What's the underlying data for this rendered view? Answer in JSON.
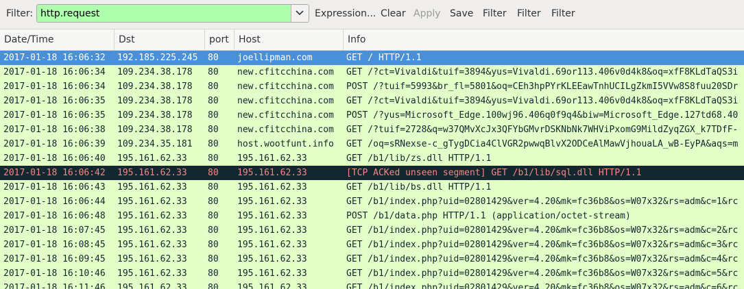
{
  "filter": {
    "label": "Filter:",
    "value": "http.request"
  },
  "toolbar": {
    "expression": "Expression...",
    "clear": "Clear",
    "apply": "Apply",
    "save": "Save",
    "filter_button_1": "Filter",
    "filter_button_2": "Filter",
    "filter_button_3": "Filter"
  },
  "columns": [
    "Date/Time",
    "Dst",
    "port",
    "Host",
    "Info"
  ],
  "colors": {
    "http_row_bg": "#e4ffc7",
    "selected_bg": "#4a90d9",
    "selected_fg": "#ffffff",
    "tcp_error_bg": "#12272e",
    "tcp_error_fg": "#f78787",
    "filter_valid_bg": "#afffaf"
  },
  "rows": [
    {
      "date": "2017-01-18 16:06:32",
      "dst": "192.185.225.245",
      "port": "80",
      "host": "joellipman.com",
      "info": "GET / HTTP/1.1",
      "style": "selected"
    },
    {
      "date": "2017-01-18 16:06:34",
      "dst": "109.234.38.178",
      "port": "80",
      "host": "new.cfitcchina.com",
      "info": "GET /?ct=Vivaldi&tuif=3894&yus=Vivaldi.69or113.406v0d4k8&oq=xfF8KLdTaQS3i",
      "style": "http"
    },
    {
      "date": "2017-01-18 16:06:34",
      "dst": "109.234.38.178",
      "port": "80",
      "host": "new.cfitcchina.com",
      "info": "POST /?tuif=5993&br_fl=5801&oq=CEh3hpPYrKLEEawTnhUCILgZkmI5VVw8S8fuu20SDr",
      "style": "http"
    },
    {
      "date": "2017-01-18 16:06:35",
      "dst": "109.234.38.178",
      "port": "80",
      "host": "new.cfitcchina.com",
      "info": "GET /?ct=Vivaldi&tuif=3894&yus=Vivaldi.69or113.406v0d4k8&oq=xfF8KLdTaQS3i",
      "style": "http"
    },
    {
      "date": "2017-01-18 16:06:35",
      "dst": "109.234.38.178",
      "port": "80",
      "host": "new.cfitcchina.com",
      "info": "POST /?yus=Microsoft_Edge.100wj96.406q0f9q4&biw=Microsoft_Edge.127td68.40",
      "style": "http"
    },
    {
      "date": "2017-01-18 16:06:38",
      "dst": "109.234.38.178",
      "port": "80",
      "host": "new.cfitcchina.com",
      "info": "GET /?tuif=2728&q=w37QMvXcJx3QFYbGMvrDSKNbNk7WHViPxomG9MildZyqZGX_k7TDfF-",
      "style": "http"
    },
    {
      "date": "2017-01-18 16:06:39",
      "dst": "109.234.35.181",
      "port": "80",
      "host": "host.wootfunt.info",
      "info": "GET /oq=sRNexse-c_gTygDCia4ClVGR2pwwqBlvX2ODCeAlMawVjhouaLA_wB-EyPA&aqs=m",
      "style": "http"
    },
    {
      "date": "2017-01-18 16:06:40",
      "dst": "195.161.62.33",
      "port": "80",
      "host": "195.161.62.33",
      "info": "GET /b1/lib/zs.dll HTTP/1.1",
      "style": "http"
    },
    {
      "date": "2017-01-18 16:06:42",
      "dst": "195.161.62.33",
      "port": "80",
      "host": "195.161.62.33",
      "info": "[TCP ACKed unseen segment] GET /b1/lib/sql.dll HTTP/1.1",
      "style": "tcp"
    },
    {
      "date": "2017-01-18 16:06:43",
      "dst": "195.161.62.33",
      "port": "80",
      "host": "195.161.62.33",
      "info": "GET /b1/lib/bs.dll HTTP/1.1",
      "style": "http"
    },
    {
      "date": "2017-01-18 16:06:44",
      "dst": "195.161.62.33",
      "port": "80",
      "host": "195.161.62.33",
      "info": "GET /b1/index.php?uid=02801429&ver=4.20&mk=fc36b8&os=W07x32&rs=adm&c=1&rc",
      "style": "http"
    },
    {
      "date": "2017-01-18 16:06:48",
      "dst": "195.161.62.33",
      "port": "80",
      "host": "195.161.62.33",
      "info": "POST /b1/data.php HTTP/1.1  (application/octet-stream)",
      "style": "http"
    },
    {
      "date": "2017-01-18 16:07:45",
      "dst": "195.161.62.33",
      "port": "80",
      "host": "195.161.62.33",
      "info": "GET /b1/index.php?uid=02801429&ver=4.20&mk=fc36b8&os=W07x32&rs=adm&c=2&rc",
      "style": "http"
    },
    {
      "date": "2017-01-18 16:08:45",
      "dst": "195.161.62.33",
      "port": "80",
      "host": "195.161.62.33",
      "info": "GET /b1/index.php?uid=02801429&ver=4.20&mk=fc36b8&os=W07x32&rs=adm&c=3&rc",
      "style": "http"
    },
    {
      "date": "2017-01-18 16:09:45",
      "dst": "195.161.62.33",
      "port": "80",
      "host": "195.161.62.33",
      "info": "GET /b1/index.php?uid=02801429&ver=4.20&mk=fc36b8&os=W07x32&rs=adm&c=4&rc",
      "style": "http"
    },
    {
      "date": "2017-01-18 16:10:46",
      "dst": "195.161.62.33",
      "port": "80",
      "host": "195.161.62.33",
      "info": "GET /b1/index.php?uid=02801429&ver=4.20&mk=fc36b8&os=W07x32&rs=adm&c=5&rc",
      "style": "http"
    },
    {
      "date": "2017-01-18 16:11:46",
      "dst": "195.161.62.33",
      "port": "80",
      "host": "195.161.62.33",
      "info": "GET /b1/index.php?uid=02801429&ver=4.20&mk=fc36b8&os=W07x32&rs=adm&c=6&rc",
      "style": "http"
    }
  ]
}
